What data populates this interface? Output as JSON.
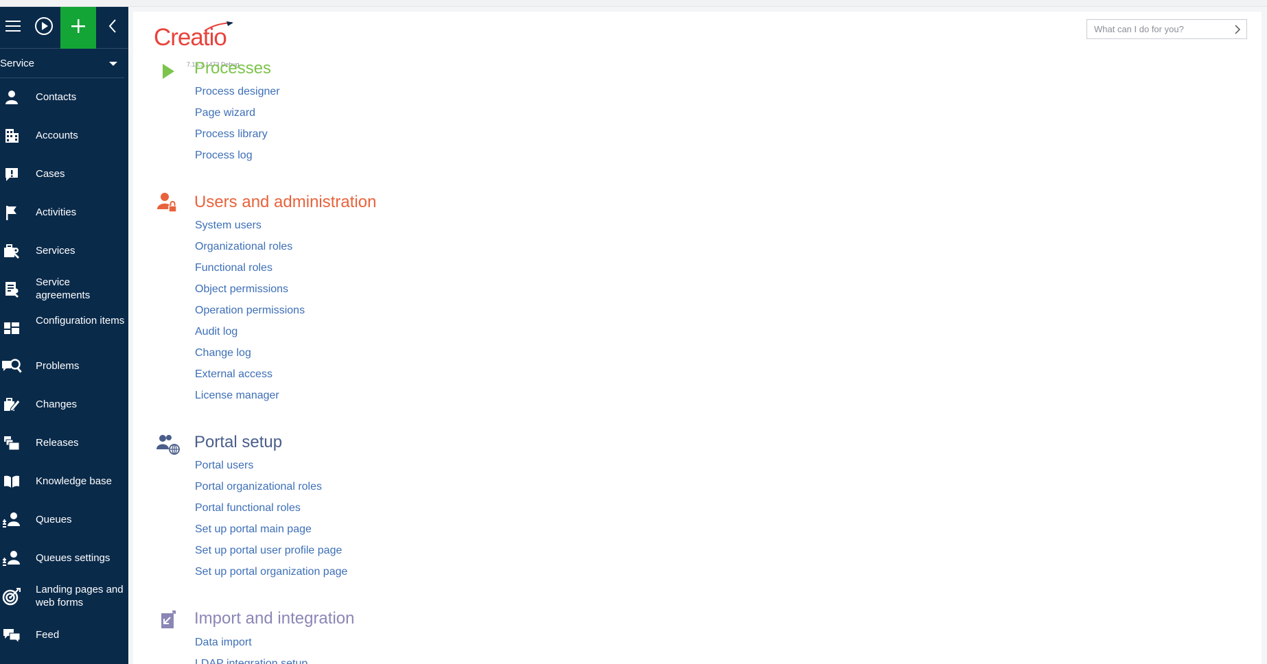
{
  "sidebar": {
    "workplace": "Service",
    "items": [
      {
        "label": "Contacts",
        "icon": "contact-icon"
      },
      {
        "label": "Accounts",
        "icon": "accounts-icon"
      },
      {
        "label": "Cases",
        "icon": "cases-icon"
      },
      {
        "label": "Activities",
        "icon": "activities-flag-icon"
      },
      {
        "label": "Services",
        "icon": "services-icon"
      },
      {
        "label": "Service agreements",
        "icon": "service-agreements-icon"
      },
      {
        "label": "Configuration items",
        "icon": "configuration-items-icon"
      },
      {
        "label": "Problems",
        "icon": "problems-icon"
      },
      {
        "label": "Changes",
        "icon": "changes-icon"
      },
      {
        "label": "Releases",
        "icon": "releases-icon"
      },
      {
        "label": "Knowledge base",
        "icon": "knowledge-base-icon"
      },
      {
        "label": "Queues",
        "icon": "queues-icon"
      },
      {
        "label": "Queues settings",
        "icon": "queues-settings-icon"
      },
      {
        "label": "Landing pages and web forms",
        "icon": "landing-pages-icon"
      },
      {
        "label": "Feed",
        "icon": "feed-icon"
      }
    ]
  },
  "header": {
    "logo_text": "Creatio",
    "version": "7.16.3.1473 Debug",
    "search_placeholder": "What can I do for you?"
  },
  "colors": {
    "sidebar_bg": "#0a2a4a",
    "add_button": "#14a537",
    "processes_title": "#7cc44b",
    "users_title": "#e8633c",
    "portal_title": "#4a5e8a",
    "import_title": "#8a86b6",
    "link": "#3d6fb7",
    "logo": "#e8433c"
  },
  "sections": [
    {
      "title": "Processes",
      "icon": "play-triangle-icon",
      "links": [
        "Process designer",
        "Page wizard",
        "Process library",
        "Process log"
      ]
    },
    {
      "title": "Users and administration",
      "icon": "user-lock-icon",
      "links": [
        "System users",
        "Organizational roles",
        "Functional roles",
        "Object permissions",
        "Operation permissions",
        "Audit log",
        "Change log",
        "External access",
        "License manager"
      ]
    },
    {
      "title": "Portal setup",
      "icon": "portal-users-globe-icon",
      "links": [
        "Portal users",
        "Portal organizational roles",
        "Portal functional roles",
        "Set up portal main page",
        "Set up portal user profile page",
        "Set up portal organization page"
      ]
    },
    {
      "title": "Import and integration",
      "icon": "import-arrow-icon",
      "links": [
        "Data import",
        "LDAP integration setup"
      ]
    }
  ]
}
